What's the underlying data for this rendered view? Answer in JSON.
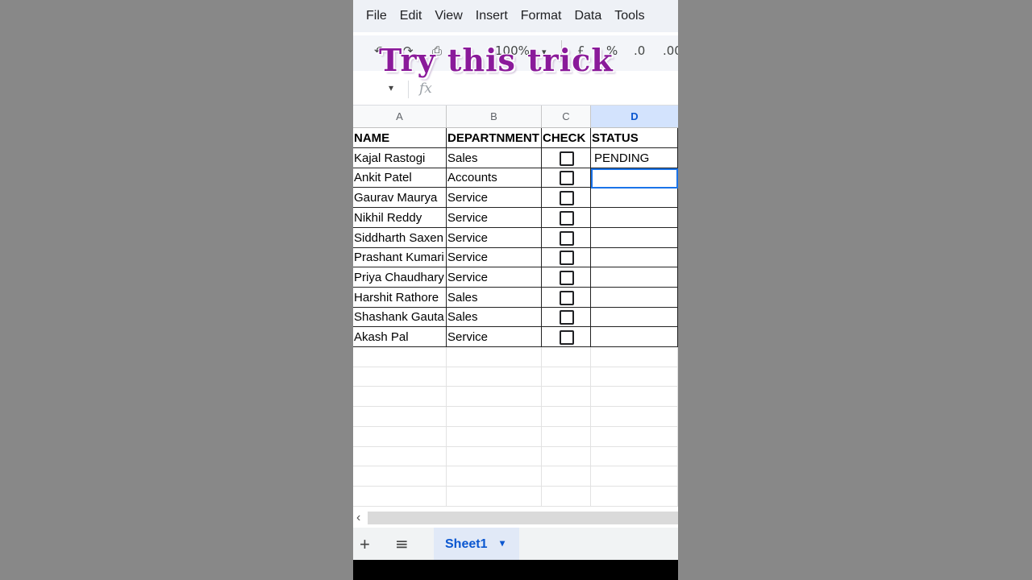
{
  "menu": [
    "File",
    "Edit",
    "View",
    "Insert",
    "Format",
    "Data",
    "Tools"
  ],
  "toolbar": {
    "zoom": "100%",
    "currency": "£",
    "percent": "%",
    "decrease_decimal": ".0",
    "increase_decimal": ".00"
  },
  "overlay_title": "Try this trick",
  "formula": {
    "fx": "fx"
  },
  "columns": [
    "A",
    "B",
    "C",
    "D"
  ],
  "table": {
    "headers": [
      "NAME",
      "DEPARTNMENT",
      "CHECK",
      "STATUS"
    ],
    "rows": [
      {
        "name": "Kajal Rastogi",
        "dept": "Sales",
        "status": "PENDING"
      },
      {
        "name": "Ankit Patel",
        "dept": "Accounts",
        "status": ""
      },
      {
        "name": "Gaurav Maurya",
        "dept": "Service",
        "status": ""
      },
      {
        "name": "Nikhil Reddy",
        "dept": "Service",
        "status": ""
      },
      {
        "name": "Siddharth Saxen",
        "dept": "Service",
        "status": ""
      },
      {
        "name": "Prashant Kumari",
        "dept": "Service",
        "status": ""
      },
      {
        "name": "Priya Chaudhary",
        "dept": "Service",
        "status": ""
      },
      {
        "name": "Harshit Rathore",
        "dept": "Sales",
        "status": ""
      },
      {
        "name": "Shashank Gauta",
        "dept": "Sales",
        "status": ""
      },
      {
        "name": "Akash Pal",
        "dept": "Service",
        "status": ""
      }
    ]
  },
  "sheet_tab": "Sheet1",
  "icons": {
    "add_sheet": "+",
    "all_sheets": "≡",
    "scroll_left": "‹",
    "dropdown": "▾"
  }
}
